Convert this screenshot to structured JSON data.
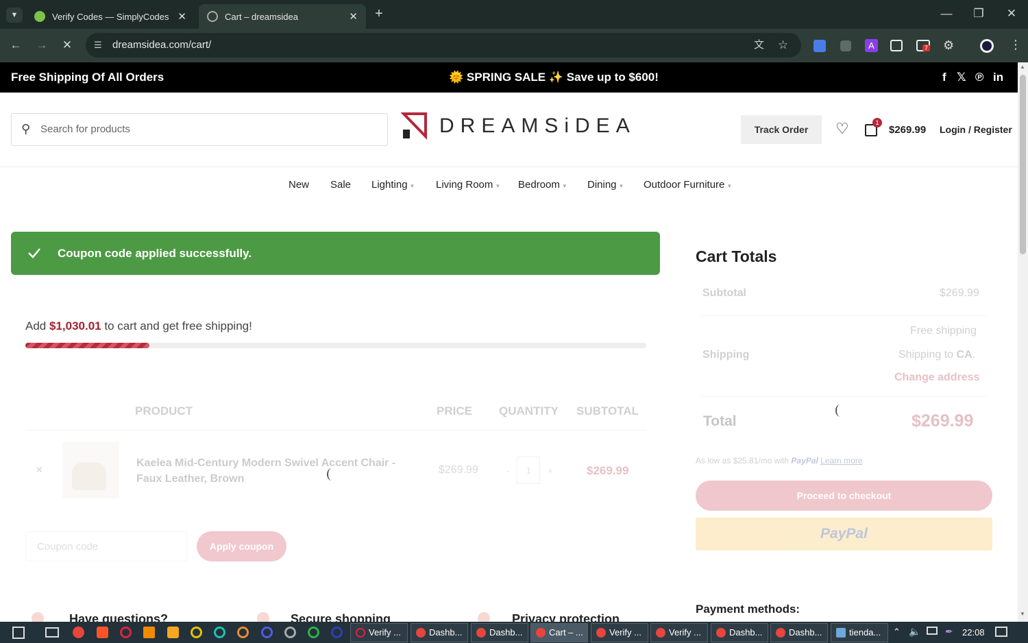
{
  "browser": {
    "tabs": [
      {
        "title": "Verify Codes — SimplyCodes",
        "favicon": "simplycodes-icon"
      },
      {
        "title": "Cart – dreamsidea",
        "favicon": "dreamsidea-icon"
      }
    ],
    "url": "dreamsidea.com/cart/",
    "extension_badge": "7"
  },
  "promo": {
    "left": "Free Shipping Of All Orders",
    "center": "🌞 SPRING  SALE ✨ Save up to $600!",
    "social": [
      "f",
      "𝕏",
      "℗",
      "in"
    ]
  },
  "header": {
    "search_placeholder": "Search for products",
    "logo_text": "DREAMSiDEA",
    "track_order": "Track Order",
    "cart_count": "1",
    "cart_total": "$269.99",
    "login": "Login / Register"
  },
  "nav": {
    "items": [
      "New",
      "Sale",
      "Lighting",
      "Living Room",
      "Bedroom",
      "Dining",
      "Outdoor Furniture"
    ]
  },
  "notice": {
    "text": "Coupon code applied successfully."
  },
  "shipping_progress": {
    "prefix": "Add ",
    "amount": "$1,030.01",
    "suffix": " to cart and get free shipping!",
    "progress_fraction": 0.2
  },
  "cart": {
    "headers": {
      "product": "PRODUCT",
      "price": "PRICE",
      "quantity": "QUANTITY",
      "subtotal": "SUBTOTAL"
    },
    "item": {
      "name": "Kaelea Mid-Century Modern Swivel Accent Chair - Faux Leather, Brown",
      "price": "$269.99",
      "quantity": "1",
      "minus": "-",
      "plus": "+",
      "subtotal": "$269.99",
      "remove": "×"
    },
    "coupon_placeholder": "Coupon code",
    "apply_label": "Apply coupon"
  },
  "totals": {
    "title": "Cart Totals",
    "subtotal_label": "Subtotal",
    "subtotal_value": "$269.99",
    "shipping_label": "Shipping",
    "shipping_method": "Free shipping",
    "shipping_to_prefix": "Shipping to ",
    "shipping_to_region": "CA",
    "shipping_to_suffix": ".",
    "change_address": "Change address",
    "total_label": "Total",
    "total_value": "$269.99",
    "paypal_msg": "As low as $25.81/mo with",
    "paypal_word": "PayPal",
    "learn_more": "Learn more",
    "checkout_label": "Proceed to checkout",
    "paypal_button": "PayPal",
    "payment_methods": "Payment methods:"
  },
  "footer_features": [
    "Have questions?",
    "Secure shopping",
    "Privacy protection"
  ],
  "taskbar": {
    "apps": [
      "Verify ...",
      "Dashb...",
      "Dashb...",
      "Cart – ...",
      "Verify ...",
      "Verify ...",
      "Dashb...",
      "Dashb...",
      "tienda..."
    ],
    "time": "22:08"
  },
  "colors": {
    "accent": "#a3222f",
    "success": "#4c9a44",
    "checkout": "#c83a4c",
    "paypal": "#f7c04a"
  }
}
